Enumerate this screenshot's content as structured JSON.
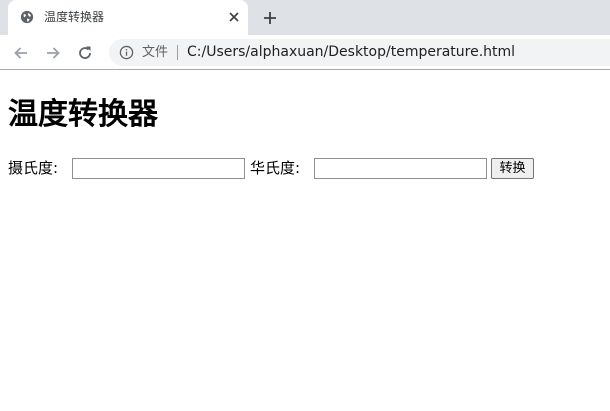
{
  "browser": {
    "tab": {
      "title": "温度转换器",
      "favicon": "globe-icon",
      "close_icon": "close-icon"
    },
    "new_tab_icon": "plus-icon",
    "toolbar": {
      "back_icon": "arrow-left-icon",
      "forward_icon": "arrow-right-icon",
      "reload_icon": "reload-icon",
      "info_icon": "info-icon",
      "site_label": "文件",
      "url": "C:/Users/alphaxuan/Desktop/temperature.html"
    }
  },
  "page": {
    "title": "温度转换器",
    "celsius_label": "摄氏度:",
    "celsius_value": "",
    "fahrenheit_label": "华氏度:",
    "fahrenheit_value": "",
    "convert_label": "转换"
  },
  "colors": {
    "tabstrip_bg": "#dee1e6",
    "omnibox_bg": "#f1f3f4",
    "icon_gray": "#5f6368",
    "button_bg": "#efefef"
  }
}
